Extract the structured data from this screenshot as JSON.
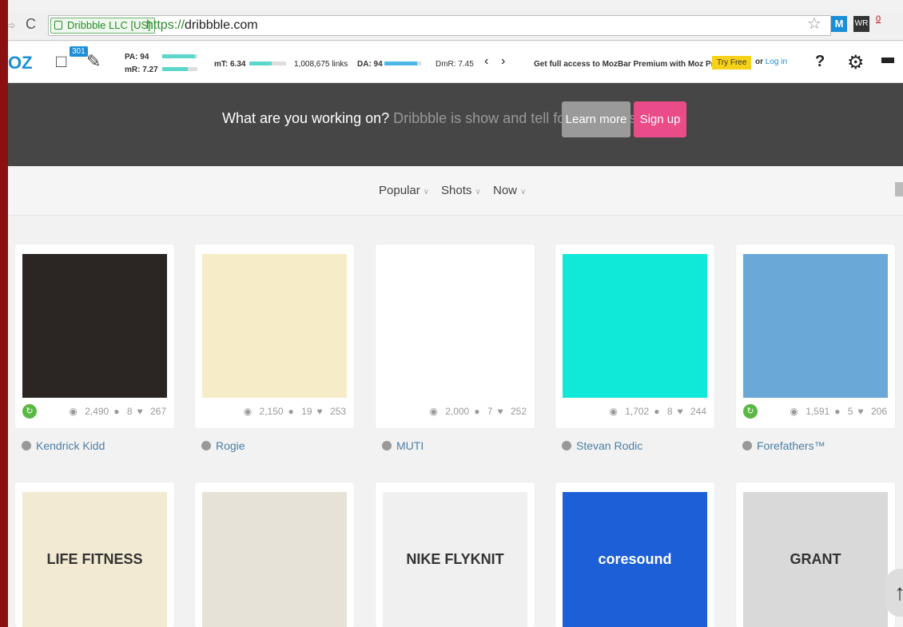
{
  "browser": {
    "ev_label": "Dribbble LLC [US]",
    "url_scheme": "https://",
    "url_host": "dribbble.com",
    "ext_m": "M",
    "ext_wr": "WR",
    "ext_count": "0"
  },
  "mozbar": {
    "logo": "OZ",
    "badge": "301",
    "pa": "PA: 94",
    "mr": "mR: 7.27",
    "mt": "mT: 6.34",
    "links": "1,008,675 links",
    "da": "DA: 94",
    "dmr": "DmR: 7.45",
    "promo": "Get full access to MozBar Premium with Moz Pro",
    "try_free": "Try Free",
    "or": "or",
    "log_in": "Log in",
    "help": "?",
    "pa_fill": 0.94,
    "mr_fill": 0.727,
    "mt_fill": 0.634,
    "da_fill": 0.94
  },
  "banner": {
    "question": "What are you working on?",
    "tagline": "Dribbble is show and tell for designers.",
    "learn_more": "Learn more",
    "sign_up": "Sign up"
  },
  "filters": [
    {
      "label": "Popular"
    },
    {
      "label": "Shots"
    },
    {
      "label": "Now"
    }
  ],
  "shots": [
    {
      "views": "2,490",
      "comments": "8",
      "likes": "267",
      "player": "Kendrick Kidd",
      "rebound": true,
      "thumb_bg": "#2b2623"
    },
    {
      "views": "2,150",
      "comments": "19",
      "likes": "253",
      "player": "Rogie",
      "rebound": false,
      "thumb_bg": "#f7ecc8"
    },
    {
      "views": "2,000",
      "comments": "7",
      "likes": "252",
      "player": "MUTI",
      "rebound": false,
      "thumb_bg": "#ffffff"
    },
    {
      "views": "1,702",
      "comments": "8",
      "likes": "244",
      "player": "Stevan Rodic",
      "rebound": false,
      "thumb_bg": "#10e8d8"
    },
    {
      "views": "1,591",
      "comments": "5",
      "likes": "206",
      "player": "Forefathers™",
      "rebound": true,
      "thumb_bg": "#6aa8d8"
    }
  ],
  "shots_row2": [
    {
      "thumb_bg": "#f3ead3",
      "text": "LIFE FITNESS"
    },
    {
      "thumb_bg": "#e7e2d8",
      "text": ""
    },
    {
      "thumb_bg": "#f0f0f0",
      "text": "NIKE FLYKNIT"
    },
    {
      "thumb_bg": "#1d5fd6",
      "text": "coresound"
    },
    {
      "thumb_bg": "#d9d9d9",
      "text": "GRANT"
    }
  ]
}
